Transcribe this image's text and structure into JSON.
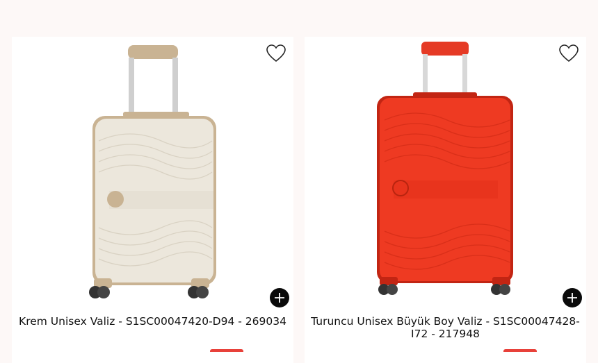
{
  "products": [
    {
      "title": "Krem Unisex Valiz - S1SC00047420-D94 - 269034",
      "image": "cream hard-shell cabin suitcase",
      "body_color": "#ece7dc",
      "accent_color": "#c9b393",
      "favorite_icon": "heart-outline-icon",
      "add_icon": "plus-icon",
      "badge_color": "#e8413a"
    },
    {
      "title": "Turuncu Unisex Büyük Boy Valiz - S1SC00047428-I72 - 217948",
      "image": "orange hard-shell large suitcase",
      "body_color": "#ee3a22",
      "accent_color": "#c22513",
      "favorite_icon": "heart-outline-icon",
      "add_icon": "plus-icon",
      "badge_color": "#e8413a"
    }
  ]
}
